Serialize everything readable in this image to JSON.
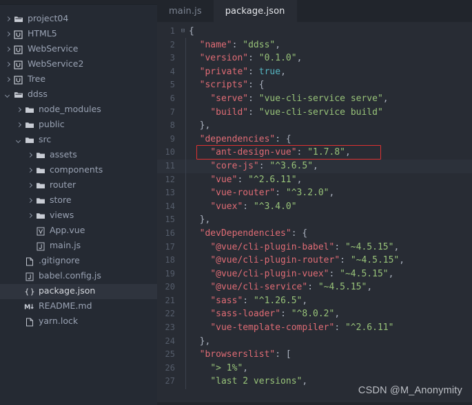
{
  "colors": {
    "sidebar_bg": "#252a33",
    "editor_bg": "#282c34",
    "tabbar_bg": "#21252c",
    "selection_bg": "#2f343e",
    "current_line_bg": "#2c313a",
    "key": "#e06c75",
    "string": "#98c379",
    "boolean": "#56b6c2",
    "punctuation": "#abb2bf",
    "gutter_text": "#555d6b",
    "annotation_box": "#e03131"
  },
  "sidebar": {
    "items": [
      {
        "label": "project04",
        "depth": 0,
        "arrow": "closed",
        "icon": "folder-module-icon",
        "selected": false
      },
      {
        "label": "HTML5",
        "depth": 0,
        "arrow": "closed",
        "icon": "module-icon",
        "selected": false
      },
      {
        "label": "WebService",
        "depth": 0,
        "arrow": "closed",
        "icon": "module-icon",
        "selected": false
      },
      {
        "label": "WebService2",
        "depth": 0,
        "arrow": "closed",
        "icon": "module-icon",
        "selected": false
      },
      {
        "label": "Tree",
        "depth": 0,
        "arrow": "closed",
        "icon": "module-icon",
        "selected": false
      },
      {
        "label": "ddss",
        "depth": 0,
        "arrow": "open",
        "icon": "folder-module-icon",
        "selected": false
      },
      {
        "label": "node_modules",
        "depth": 1,
        "arrow": "closed",
        "icon": "folder-icon",
        "selected": false
      },
      {
        "label": "public",
        "depth": 1,
        "arrow": "closed",
        "icon": "folder-icon",
        "selected": false
      },
      {
        "label": "src",
        "depth": 1,
        "arrow": "open",
        "icon": "folder-icon",
        "selected": false
      },
      {
        "label": "assets",
        "depth": 2,
        "arrow": "closed",
        "icon": "folder-icon",
        "selected": false
      },
      {
        "label": "components",
        "depth": 2,
        "arrow": "closed",
        "icon": "folder-icon",
        "selected": false
      },
      {
        "label": "router",
        "depth": 2,
        "arrow": "closed",
        "icon": "folder-icon",
        "selected": false
      },
      {
        "label": "store",
        "depth": 2,
        "arrow": "closed",
        "icon": "folder-icon",
        "selected": false
      },
      {
        "label": "views",
        "depth": 2,
        "arrow": "closed",
        "icon": "folder-icon",
        "selected": false
      },
      {
        "label": "App.vue",
        "depth": 2,
        "arrow": "none",
        "icon": "vue-file-icon",
        "selected": false
      },
      {
        "label": "main.js",
        "depth": 2,
        "arrow": "none",
        "icon": "js-file-icon",
        "selected": false
      },
      {
        "label": ".gitignore",
        "depth": 1,
        "arrow": "none",
        "icon": "plain-file-icon",
        "selected": false
      },
      {
        "label": "babel.config.js",
        "depth": 1,
        "arrow": "none",
        "icon": "js-file-icon",
        "selected": false
      },
      {
        "label": "package.json",
        "depth": 1,
        "arrow": "none",
        "icon": "json-file-icon",
        "selected": true
      },
      {
        "label": "README.md",
        "depth": 1,
        "arrow": "none",
        "icon": "markdown-file-icon",
        "selected": false
      },
      {
        "label": "yarn.lock",
        "depth": 1,
        "arrow": "none",
        "icon": "plain-file-icon",
        "selected": false
      }
    ]
  },
  "tabs": [
    {
      "label": "main.js",
      "active": false
    },
    {
      "label": "package.json",
      "active": true
    }
  ],
  "editor": {
    "current_line": 11,
    "fold_line": 1,
    "lines": [
      {
        "n": 1,
        "indent": 0,
        "tokens": [
          {
            "t": "p",
            "v": "{"
          }
        ]
      },
      {
        "n": 2,
        "indent": 1,
        "tokens": [
          {
            "t": "k",
            "v": "\"name\""
          },
          {
            "t": "p",
            "v": ": "
          },
          {
            "t": "s",
            "v": "\"ddss\""
          },
          {
            "t": "p",
            "v": ","
          }
        ]
      },
      {
        "n": 3,
        "indent": 1,
        "tokens": [
          {
            "t": "k",
            "v": "\"version\""
          },
          {
            "t": "p",
            "v": ": "
          },
          {
            "t": "s",
            "v": "\"0.1.0\""
          },
          {
            "t": "p",
            "v": ","
          }
        ]
      },
      {
        "n": 4,
        "indent": 1,
        "tokens": [
          {
            "t": "k",
            "v": "\"private\""
          },
          {
            "t": "p",
            "v": ": "
          },
          {
            "t": "b",
            "v": "true"
          },
          {
            "t": "p",
            "v": ","
          }
        ]
      },
      {
        "n": 5,
        "indent": 1,
        "tokens": [
          {
            "t": "k",
            "v": "\"scripts\""
          },
          {
            "t": "p",
            "v": ": {"
          }
        ]
      },
      {
        "n": 6,
        "indent": 2,
        "tokens": [
          {
            "t": "k",
            "v": "\"serve\""
          },
          {
            "t": "p",
            "v": ": "
          },
          {
            "t": "s",
            "v": "\"vue-cli-service serve\""
          },
          {
            "t": "p",
            "v": ","
          }
        ]
      },
      {
        "n": 7,
        "indent": 2,
        "tokens": [
          {
            "t": "k",
            "v": "\"build\""
          },
          {
            "t": "p",
            "v": ": "
          },
          {
            "t": "s",
            "v": "\"vue-cli-service build\""
          }
        ]
      },
      {
        "n": 8,
        "indent": 1,
        "tokens": [
          {
            "t": "p",
            "v": "},"
          }
        ]
      },
      {
        "n": 9,
        "indent": 1,
        "tokens": [
          {
            "t": "k",
            "v": "\"dependencies\""
          },
          {
            "t": "p",
            "v": ": {"
          }
        ]
      },
      {
        "n": 10,
        "indent": 2,
        "tokens": [
          {
            "t": "k",
            "v": "\"ant-design-vue\""
          },
          {
            "t": "p",
            "v": ": "
          },
          {
            "t": "s",
            "v": "\"1.7.8\""
          },
          {
            "t": "p",
            "v": ","
          }
        ]
      },
      {
        "n": 11,
        "indent": 2,
        "tokens": [
          {
            "t": "k",
            "v": "\"core-js\""
          },
          {
            "t": "p",
            "v": ": "
          },
          {
            "t": "s",
            "v": "\"^3.6.5\""
          },
          {
            "t": "p",
            "v": ","
          }
        ]
      },
      {
        "n": 12,
        "indent": 2,
        "tokens": [
          {
            "t": "k",
            "v": "\"vue\""
          },
          {
            "t": "p",
            "v": ": "
          },
          {
            "t": "s",
            "v": "\"^2.6.11\""
          },
          {
            "t": "p",
            "v": ","
          }
        ]
      },
      {
        "n": 13,
        "indent": 2,
        "tokens": [
          {
            "t": "k",
            "v": "\"vue-router\""
          },
          {
            "t": "p",
            "v": ": "
          },
          {
            "t": "s",
            "v": "\"^3.2.0\""
          },
          {
            "t": "p",
            "v": ","
          }
        ]
      },
      {
        "n": 14,
        "indent": 2,
        "tokens": [
          {
            "t": "k",
            "v": "\"vuex\""
          },
          {
            "t": "p",
            "v": ": "
          },
          {
            "t": "s",
            "v": "\"^3.4.0\""
          }
        ]
      },
      {
        "n": 15,
        "indent": 1,
        "tokens": [
          {
            "t": "p",
            "v": "},"
          }
        ]
      },
      {
        "n": 16,
        "indent": 1,
        "tokens": [
          {
            "t": "k",
            "v": "\"devDependencies\""
          },
          {
            "t": "p",
            "v": ": {"
          }
        ]
      },
      {
        "n": 17,
        "indent": 2,
        "tokens": [
          {
            "t": "k",
            "v": "\"@vue/cli-plugin-babel\""
          },
          {
            "t": "p",
            "v": ": "
          },
          {
            "t": "s",
            "v": "\"~4.5.15\""
          },
          {
            "t": "p",
            "v": ","
          }
        ]
      },
      {
        "n": 18,
        "indent": 2,
        "tokens": [
          {
            "t": "k",
            "v": "\"@vue/cli-plugin-router\""
          },
          {
            "t": "p",
            "v": ": "
          },
          {
            "t": "s",
            "v": "\"~4.5.15\""
          },
          {
            "t": "p",
            "v": ","
          }
        ]
      },
      {
        "n": 19,
        "indent": 2,
        "tokens": [
          {
            "t": "k",
            "v": "\"@vue/cli-plugin-vuex\""
          },
          {
            "t": "p",
            "v": ": "
          },
          {
            "t": "s",
            "v": "\"~4.5.15\""
          },
          {
            "t": "p",
            "v": ","
          }
        ]
      },
      {
        "n": 20,
        "indent": 2,
        "tokens": [
          {
            "t": "k",
            "v": "\"@vue/cli-service\""
          },
          {
            "t": "p",
            "v": ": "
          },
          {
            "t": "s",
            "v": "\"~4.5.15\""
          },
          {
            "t": "p",
            "v": ","
          }
        ]
      },
      {
        "n": 21,
        "indent": 2,
        "tokens": [
          {
            "t": "k",
            "v": "\"sass\""
          },
          {
            "t": "p",
            "v": ": "
          },
          {
            "t": "s",
            "v": "\"^1.26.5\""
          },
          {
            "t": "p",
            "v": ","
          }
        ]
      },
      {
        "n": 22,
        "indent": 2,
        "tokens": [
          {
            "t": "k",
            "v": "\"sass-loader\""
          },
          {
            "t": "p",
            "v": ": "
          },
          {
            "t": "s",
            "v": "\"^8.0.2\""
          },
          {
            "t": "p",
            "v": ","
          }
        ]
      },
      {
        "n": 23,
        "indent": 2,
        "tokens": [
          {
            "t": "k",
            "v": "\"vue-template-compiler\""
          },
          {
            "t": "p",
            "v": ": "
          },
          {
            "t": "s",
            "v": "\"^2.6.11\""
          }
        ]
      },
      {
        "n": 24,
        "indent": 1,
        "tokens": [
          {
            "t": "p",
            "v": "},"
          }
        ]
      },
      {
        "n": 25,
        "indent": 1,
        "tokens": [
          {
            "t": "k",
            "v": "\"browserslist\""
          },
          {
            "t": "p",
            "v": ": ["
          }
        ]
      },
      {
        "n": 26,
        "indent": 2,
        "tokens": [
          {
            "t": "s",
            "v": "\"> 1%\""
          },
          {
            "t": "p",
            "v": ","
          }
        ]
      },
      {
        "n": 27,
        "indent": 2,
        "tokens": [
          {
            "t": "s",
            "v": "\"last 2 versions\""
          },
          {
            "t": "p",
            "v": ","
          }
        ]
      }
    ],
    "annotation": {
      "line": 10,
      "label": "ant-design-vue-highlight-box"
    }
  },
  "watermark": {
    "text": "CSDN @M_Anonymity"
  }
}
